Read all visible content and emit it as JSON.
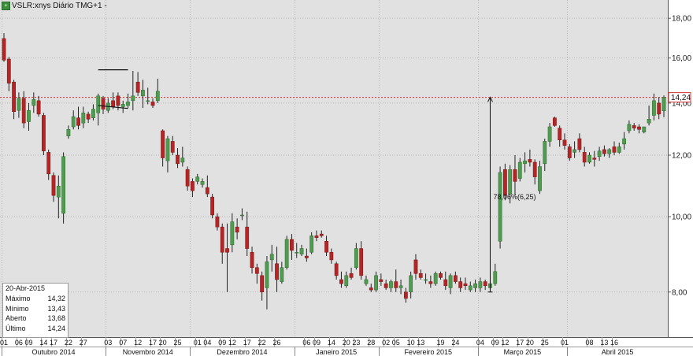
{
  "header": {
    "title": "VSLR:xnys Diário TMG+1  -"
  },
  "info_box": {
    "date": "20-Abr-2015",
    "rows": [
      {
        "label": "Máximo",
        "value": "14,32"
      },
      {
        "label": "Mínimo",
        "value": "13,43"
      },
      {
        "label": "Aberto",
        "value": "13,68"
      },
      {
        "label": "Último",
        "value": "14,24"
      }
    ]
  },
  "colors": {
    "up": "#4f9b4f",
    "down": "#b52525",
    "wick": "#222222",
    "grid": "#b7b7b7",
    "background": "#e1e1e1",
    "last_line": "#d23030"
  },
  "chart_data": {
    "type": "candlestick",
    "y_scale": "log",
    "ylim": [
      7.0,
      19.0
    ],
    "y_ticks": [
      "8,00",
      "10,00",
      "12,00",
      "14,00",
      "16,00",
      "18,00"
    ],
    "y_tick_values": [
      8,
      10,
      12,
      14,
      16,
      18
    ],
    "last_value": 14.24,
    "last_label": "14,24",
    "x_day_labels": [
      "01",
      "06",
      "09",
      "14",
      "17",
      "22",
      "27",
      "03",
      "07",
      "12",
      "17",
      "20",
      "25",
      "01",
      "04",
      "09",
      "12",
      "17",
      "22",
      "26",
      "06",
      "09",
      "14",
      "20",
      "23",
      "28",
      "02",
      "05",
      "10",
      "13",
      "19",
      "24",
      "04",
      "09",
      "12",
      "17",
      "20",
      "25",
      "01",
      "08",
      "13",
      "16"
    ],
    "x_day_label_indices": [
      0,
      3,
      5,
      8,
      10,
      13,
      16,
      21,
      24,
      27,
      30,
      32,
      35,
      39,
      41,
      44,
      46,
      49,
      52,
      55,
      61,
      63,
      66,
      69,
      71,
      74,
      77,
      79,
      82,
      84,
      88,
      91,
      96,
      99,
      101,
      104,
      106,
      109,
      113,
      118,
      121,
      123
    ],
    "x_month_labels": [
      "Outubro 2014",
      "Novembro 2014",
      "Dezembro 2014",
      "Janeiro 2015",
      "Fevereiro 2015",
      "Março 2015",
      "Abril 2015"
    ],
    "x_month_start_indices": [
      0,
      21,
      38,
      59,
      76,
      96,
      114
    ],
    "annotation": {
      "label": "78,06%(6,25)",
      "from_index": 98,
      "from_value": 8.0,
      "to_index": 98,
      "to_value": 14.25
    },
    "pattern_lines": [
      {
        "start_index": 19,
        "end_index": 25,
        "start_value": 15.45,
        "end_value": 15.45
      },
      {
        "start_index": 19,
        "end_index": 25,
        "start_value": 13.9,
        "end_value": 13.78
      }
    ],
    "candles": [
      [
        16.95,
        17.22,
        15.82,
        15.9
      ],
      [
        15.95,
        16.05,
        14.5,
        14.85
      ],
      [
        14.9,
        15.0,
        13.35,
        13.65
      ],
      [
        13.7,
        14.45,
        13.4,
        14.2
      ],
      [
        14.2,
        14.5,
        13.0,
        13.2
      ],
      [
        13.25,
        14.0,
        12.9,
        13.7
      ],
      [
        13.9,
        14.45,
        13.6,
        14.15
      ],
      [
        14.1,
        14.3,
        13.45,
        13.55
      ],
      [
        13.5,
        13.6,
        12.0,
        12.15
      ],
      [
        12.1,
        12.2,
        11.15,
        11.35
      ],
      [
        11.3,
        11.4,
        10.45,
        10.65
      ],
      [
        10.6,
        11.3,
        9.95,
        10.95
      ],
      [
        10.1,
        12.1,
        9.8,
        11.95
      ],
      [
        12.7,
        13.1,
        12.6,
        12.95
      ],
      [
        13.05,
        13.7,
        12.95,
        13.45
      ],
      [
        13.4,
        13.85,
        12.95,
        13.1
      ],
      [
        13.2,
        13.85,
        13.0,
        13.6
      ],
      [
        13.55,
        13.65,
        13.2,
        13.35
      ],
      [
        13.4,
        13.95,
        13.3,
        13.75
      ],
      [
        13.6,
        14.4,
        13.1,
        14.3
      ],
      [
        14.2,
        14.3,
        13.55,
        13.75
      ],
      [
        13.7,
        14.2,
        13.6,
        14.0
      ],
      [
        14.1,
        14.45,
        13.75,
        13.85
      ],
      [
        14.3,
        14.45,
        13.7,
        13.9
      ],
      [
        13.85,
        14.1,
        13.6,
        13.95
      ],
      [
        13.9,
        14.4,
        13.8,
        14.05
      ],
      [
        14.1,
        15.4,
        13.7,
        14.3
      ],
      [
        14.9,
        15.35,
        14.3,
        14.45
      ],
      [
        14.3,
        15.0,
        13.8,
        14.55
      ],
      [
        14.1,
        14.65,
        13.95,
        14.1
      ],
      [
        14.05,
        14.2,
        13.8,
        13.9
      ],
      [
        14.1,
        15.05,
        14.0,
        14.5
      ],
      [
        12.9,
        12.95,
        11.6,
        11.9
      ],
      [
        11.8,
        12.7,
        11.4,
        12.6
      ],
      [
        12.5,
        12.7,
        12.0,
        12.1
      ],
      [
        12.0,
        12.25,
        11.55,
        11.7
      ],
      [
        11.75,
        12.3,
        11.6,
        11.9
      ],
      [
        11.5,
        11.6,
        10.8,
        10.95
      ],
      [
        11.1,
        11.2,
        10.6,
        10.8
      ],
      [
        11.1,
        11.35,
        11.0,
        11.25
      ],
      [
        11.0,
        11.2,
        10.9,
        11.1
      ],
      [
        10.9,
        11.3,
        10.6,
        10.7
      ],
      [
        10.6,
        10.7,
        9.95,
        10.05
      ],
      [
        10.0,
        10.1,
        9.6,
        9.7
      ],
      [
        9.7,
        9.8,
        8.7,
        9.0
      ],
      [
        9.1,
        9.8,
        8.0,
        9.0
      ],
      [
        9.2,
        10.1,
        9.0,
        9.85
      ],
      [
        9.7,
        9.95,
        9.35,
        9.55
      ],
      [
        10.05,
        10.25,
        9.9,
        10.05
      ],
      [
        9.7,
        10.15,
        8.9,
        9.1
      ],
      [
        9.0,
        9.15,
        8.45,
        8.6
      ],
      [
        8.6,
        8.7,
        8.2,
        8.45
      ],
      [
        8.4,
        8.5,
        7.8,
        8.0
      ],
      [
        8.1,
        8.9,
        7.6,
        8.75
      ],
      [
        8.8,
        9.2,
        8.5,
        8.95
      ],
      [
        8.7,
        9.15,
        8.0,
        8.3
      ],
      [
        8.25,
        8.75,
        8.2,
        8.6
      ],
      [
        8.6,
        9.45,
        8.55,
        9.35
      ],
      [
        9.35,
        9.5,
        8.8,
        9.05
      ],
      [
        9.0,
        9.25,
        8.85,
        9.0
      ],
      [
        8.95,
        9.2,
        8.9,
        9.1
      ],
      [
        8.9,
        9.1,
        8.75,
        8.85
      ],
      [
        9.0,
        9.55,
        8.95,
        9.45
      ],
      [
        9.45,
        9.6,
        9.3,
        9.4
      ],
      [
        9.5,
        9.6,
        9.4,
        9.45
      ],
      [
        9.3,
        9.45,
        8.9,
        9.0
      ],
      [
        9.0,
        9.1,
        8.7,
        8.8
      ],
      [
        8.7,
        8.75,
        8.3,
        8.4
      ],
      [
        8.3,
        8.5,
        8.1,
        8.2
      ],
      [
        8.15,
        8.5,
        8.1,
        8.4
      ],
      [
        8.45,
        8.6,
        8.3,
        8.35
      ],
      [
        8.6,
        9.25,
        8.55,
        9.1
      ],
      [
        9.1,
        9.3,
        8.3,
        8.4
      ],
      [
        8.2,
        8.4,
        8.15,
        8.3
      ],
      [
        8.1,
        8.2,
        8.0,
        8.05
      ],
      [
        8.05,
        8.5,
        8.0,
        8.4
      ],
      [
        8.3,
        8.45,
        8.15,
        8.25
      ],
      [
        8.2,
        8.3,
        8.05,
        8.1
      ],
      [
        8.1,
        8.3,
        8.0,
        8.25
      ],
      [
        8.25,
        8.55,
        8.0,
        8.1
      ],
      [
        8.1,
        8.3,
        7.95,
        8.15
      ],
      [
        8.0,
        8.1,
        7.75,
        7.85
      ],
      [
        8.0,
        8.5,
        7.85,
        8.4
      ],
      [
        8.8,
        8.95,
        8.3,
        8.45
      ],
      [
        8.45,
        8.55,
        8.3,
        8.35
      ],
      [
        8.3,
        8.45,
        8.2,
        8.3
      ],
      [
        8.25,
        8.4,
        8.1,
        8.2
      ],
      [
        8.2,
        8.5,
        8.15,
        8.45
      ],
      [
        8.45,
        8.5,
        8.3,
        8.35
      ],
      [
        8.3,
        8.5,
        8.05,
        8.15
      ],
      [
        8.1,
        8.45,
        7.95,
        8.4
      ],
      [
        8.4,
        8.5,
        8.2,
        8.25
      ],
      [
        8.25,
        8.35,
        8.0,
        8.1
      ],
      [
        8.2,
        8.35,
        8.05,
        8.15
      ],
      [
        8.05,
        8.25,
        8.0,
        8.15
      ],
      [
        8.1,
        8.3,
        8.0,
        8.2
      ],
      [
        8.1,
        8.35,
        8.0,
        8.25
      ],
      [
        8.25,
        8.3,
        8.05,
        8.15
      ],
      [
        8.1,
        8.25,
        8.05,
        8.2
      ],
      [
        8.2,
        8.7,
        8.15,
        8.5
      ],
      [
        9.3,
        11.6,
        9.1,
        11.4
      ],
      [
        11.5,
        11.7,
        10.5,
        10.65
      ],
      [
        10.7,
        11.65,
        10.4,
        11.5
      ],
      [
        11.5,
        12.0,
        10.65,
        11.1
      ],
      [
        11.2,
        11.9,
        11.1,
        11.75
      ],
      [
        11.7,
        12.1,
        11.4,
        11.8
      ],
      [
        11.85,
        12.2,
        11.6,
        11.75
      ],
      [
        11.75,
        11.85,
        11.0,
        11.25
      ],
      [
        10.8,
        11.8,
        10.7,
        11.6
      ],
      [
        11.7,
        12.6,
        11.45,
        12.5
      ],
      [
        12.5,
        13.2,
        12.3,
        13.05
      ],
      [
        13.4,
        13.45,
        13.05,
        13.1
      ],
      [
        13.0,
        13.1,
        12.3,
        12.55
      ],
      [
        12.55,
        12.8,
        12.2,
        12.35
      ],
      [
        12.3,
        12.4,
        11.8,
        11.9
      ],
      [
        12.1,
        12.5,
        11.9,
        12.2
      ],
      [
        12.6,
        12.8,
        12.1,
        12.2
      ],
      [
        12.1,
        12.3,
        11.6,
        11.75
      ],
      [
        11.75,
        12.1,
        11.7,
        12.0
      ],
      [
        11.9,
        12.15,
        11.6,
        11.85
      ],
      [
        11.95,
        12.3,
        11.8,
        12.15
      ],
      [
        12.2,
        12.35,
        11.95,
        12.05
      ],
      [
        12.05,
        12.25,
        11.9,
        12.2
      ],
      [
        12.3,
        12.5,
        12.0,
        12.1
      ],
      [
        12.1,
        12.45,
        12.05,
        12.3
      ],
      [
        12.4,
        12.85,
        12.2,
        12.6
      ],
      [
        12.9,
        13.3,
        12.8,
        13.15
      ],
      [
        13.1,
        13.2,
        12.9,
        13.0
      ],
      [
        13.05,
        13.15,
        12.8,
        12.95
      ],
      [
        12.85,
        13.05,
        12.8,
        13.05
      ],
      [
        13.2,
        13.9,
        13.1,
        13.35
      ],
      [
        13.5,
        14.4,
        13.3,
        14.1
      ],
      [
        14.0,
        14.25,
        13.35,
        13.55
      ],
      [
        13.68,
        14.32,
        13.43,
        14.24
      ]
    ]
  }
}
